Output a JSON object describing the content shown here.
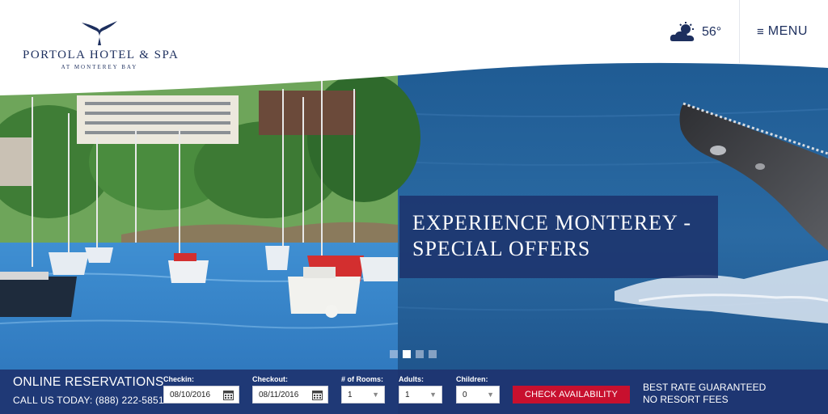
{
  "header": {
    "brand_name": "PORTOLA HOTEL & SPA",
    "brand_sub": "AT MONTEREY BAY",
    "weather_temp": "56°",
    "menu_label": "MENU"
  },
  "hero": {
    "offer_title_line1": "EXPERIENCE MONTEREY -",
    "offer_title_line2": "SPECIAL OFFERS",
    "slide_count": 4,
    "active_slide": 2
  },
  "reservations": {
    "title": "ONLINE RESERVATIONS",
    "phone": "CALL US TODAY: (888) 222-5851",
    "checkin_label": "Checkin:",
    "checkin_value": "08/10/2016",
    "checkout_label": "Checkout:",
    "checkout_value": "08/11/2016",
    "rooms_label": "# of Rooms:",
    "rooms_value": "1",
    "adults_label": "Adults:",
    "adults_value": "1",
    "children_label": "Children:",
    "children_value": "0",
    "button_label": "CHECK AVAILABILITY",
    "best_rate_line1": "BEST RATE GUARANTEED",
    "best_rate_line2": "NO RESORT FEES"
  },
  "colors": {
    "brand_navy": "#1d2f5e",
    "bar_blue": "#1e3470",
    "cta_red": "#c8102e"
  }
}
